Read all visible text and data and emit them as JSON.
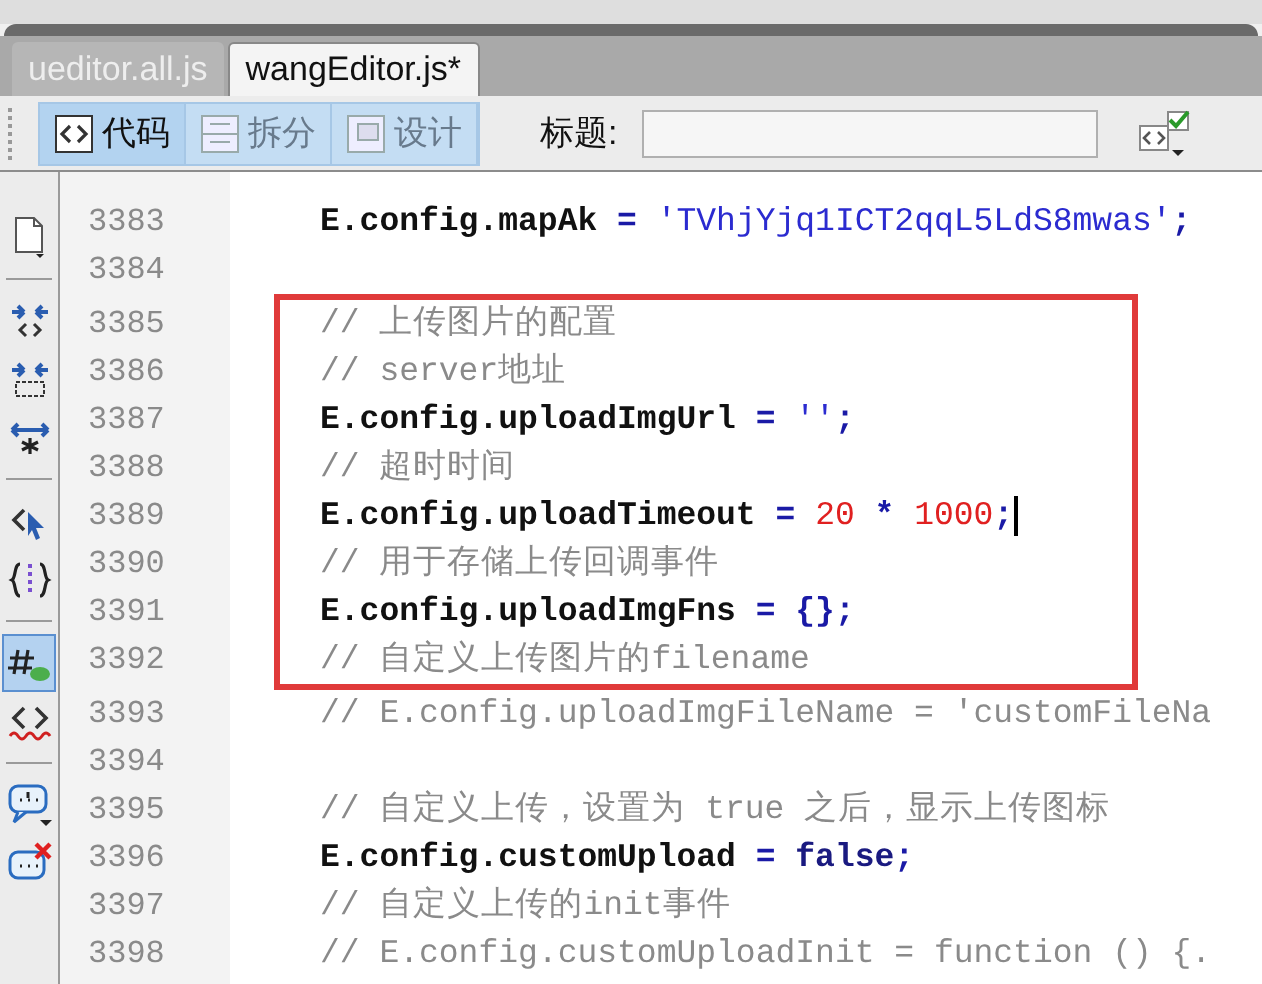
{
  "tabs": [
    {
      "label": "ueditor.all.js",
      "selected": false
    },
    {
      "label": "wangEditor.js*",
      "selected": true
    }
  ],
  "toolbar": {
    "views": [
      {
        "kind": "code",
        "label": "代码",
        "selected": true,
        "disabled": false
      },
      {
        "kind": "split",
        "label": "拆分",
        "selected": false,
        "disabled": true
      },
      {
        "kind": "design",
        "label": "设计",
        "selected": false,
        "disabled": true
      }
    ],
    "title_label": "标题:"
  },
  "gutter_groups": [
    {
      "tools": [
        {
          "kind": "document",
          "selected": false
        }
      ]
    },
    {
      "tools": [
        {
          "kind": "collapse-tag",
          "selected": false
        },
        {
          "kind": "collapse-selection",
          "selected": false
        },
        {
          "kind": "expand-all",
          "selected": false
        }
      ]
    },
    {
      "tools": [
        {
          "kind": "select-parent",
          "selected": false
        },
        {
          "kind": "balance-braces",
          "selected": false
        }
      ]
    },
    {
      "tools": [
        {
          "kind": "line-numbers",
          "selected": true
        },
        {
          "kind": "invalid-code",
          "selected": false
        }
      ]
    },
    {
      "tools": [
        {
          "kind": "comment",
          "selected": false
        },
        {
          "kind": "remove-comment",
          "selected": false
        }
      ]
    }
  ],
  "code_blocks": [
    {
      "highlighted": false,
      "lines": [
        {
          "number": "3383",
          "caret": false,
          "tokens": [
            {
              "kind": "plain",
              "text": "E.config.mapAk"
            },
            {
              "kind": "operator",
              "text": " = "
            },
            {
              "kind": "string",
              "text": "'TVhjYjq1ICT2qqL5LdS8mwas'"
            },
            {
              "kind": "operator",
              "text": ";"
            }
          ]
        },
        {
          "number": "3384",
          "caret": false
        }
      ]
    },
    {
      "highlighted": true,
      "lines": [
        {
          "number": "3385",
          "caret": false,
          "tokens": [
            {
              "kind": "comment",
              "text": "// 上传图片的配置"
            }
          ]
        },
        {
          "number": "3386",
          "caret": false,
          "tokens": [
            {
              "kind": "comment",
              "text": "// server地址"
            }
          ]
        },
        {
          "number": "3387",
          "caret": false,
          "tokens": [
            {
              "kind": "plain",
              "text": "E.config.uploadImgUrl"
            },
            {
              "kind": "operator",
              "text": " = "
            },
            {
              "kind": "string",
              "text": "''"
            },
            {
              "kind": "operator",
              "text": ";"
            }
          ]
        },
        {
          "number": "3388",
          "caret": false,
          "tokens": [
            {
              "kind": "comment",
              "text": "// 超时时间"
            }
          ]
        },
        {
          "number": "3389",
          "caret": true,
          "tokens": [
            {
              "kind": "plain",
              "text": "E.config.uploadTimeout"
            },
            {
              "kind": "operator",
              "text": " = "
            },
            {
              "kind": "number",
              "text": "20"
            },
            {
              "kind": "operator",
              "text": " * "
            },
            {
              "kind": "number",
              "text": "1000"
            },
            {
              "kind": "operator",
              "text": ";"
            }
          ]
        },
        {
          "number": "3390",
          "caret": false,
          "tokens": [
            {
              "kind": "comment",
              "text": "// 用于存储上传回调事件"
            }
          ]
        },
        {
          "number": "3391",
          "caret": false,
          "tokens": [
            {
              "kind": "plain",
              "text": "E.config.uploadImgFns"
            },
            {
              "kind": "operator",
              "text": " = {};"
            }
          ]
        },
        {
          "number": "3392",
          "caret": false,
          "tokens": [
            {
              "kind": "comment",
              "text": "// 自定义上传图片的filename"
            }
          ]
        }
      ]
    },
    {
      "highlighted": false,
      "lines": [
        {
          "number": "3393",
          "caret": false,
          "tokens": [
            {
              "kind": "comment",
              "text": "// E.config.uploadImgFileName = 'customFileNa"
            }
          ]
        },
        {
          "number": "3394",
          "caret": false
        },
        {
          "number": "3395",
          "caret": false,
          "tokens": [
            {
              "kind": "comment",
              "text": "// 自定义上传，设置为 true 之后，显示上传图标"
            }
          ]
        },
        {
          "number": "3396",
          "caret": false,
          "tokens": [
            {
              "kind": "plain",
              "text": "E.config.customUpload"
            },
            {
              "kind": "operator",
              "text": " = "
            },
            {
              "kind": "keyword",
              "text": "false"
            },
            {
              "kind": "operator",
              "text": ";"
            }
          ]
        },
        {
          "number": "3397",
          "caret": false,
          "tokens": [
            {
              "kind": "comment",
              "text": "// 自定义上传的init事件"
            }
          ]
        },
        {
          "number": "3398",
          "caret": false,
          "tokens": [
            {
              "kind": "comment",
              "text": "// E.config.customUploadInit = function () {."
            }
          ]
        }
      ]
    }
  ]
}
